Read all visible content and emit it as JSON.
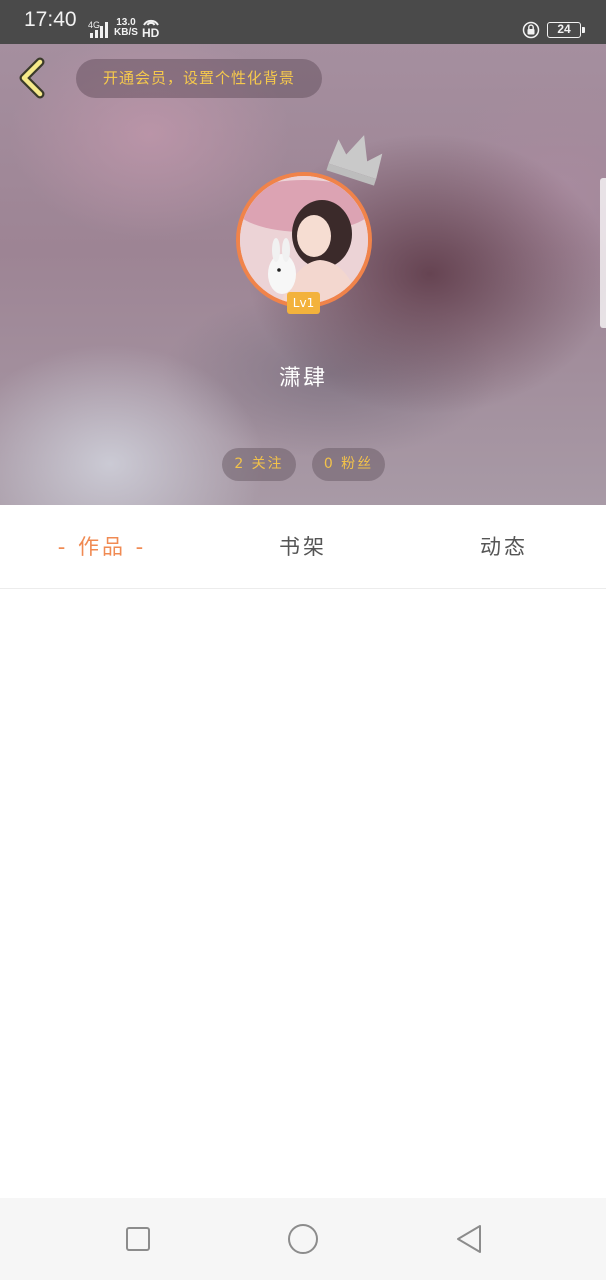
{
  "status_bar": {
    "time": "17:40",
    "network": "4G",
    "speed_value": "13.0",
    "speed_unit": "KB/S",
    "hd": "HD",
    "battery": "24"
  },
  "header": {
    "back_icon": "chevron-left-icon",
    "vip_banner": "开通会员，设置个性化背景",
    "crown_icon": "crown-icon",
    "level": "Lv1",
    "username": "潇肆",
    "stats": {
      "follow": "2 关注",
      "fans": "0 粉丝"
    }
  },
  "tabs": [
    {
      "label": "- 作品 -",
      "active": true
    },
    {
      "label": "书架",
      "active": false
    },
    {
      "label": "动态",
      "active": false
    }
  ],
  "nav_bar": {
    "recent_icon": "square-icon",
    "home_icon": "circle-icon",
    "back_icon": "triangle-back-icon"
  },
  "colors": {
    "accent": "#f08a52",
    "gold_text": "#f2c24a",
    "level_badge": "#f3b23c",
    "status_bar": "#4a4a4a"
  }
}
